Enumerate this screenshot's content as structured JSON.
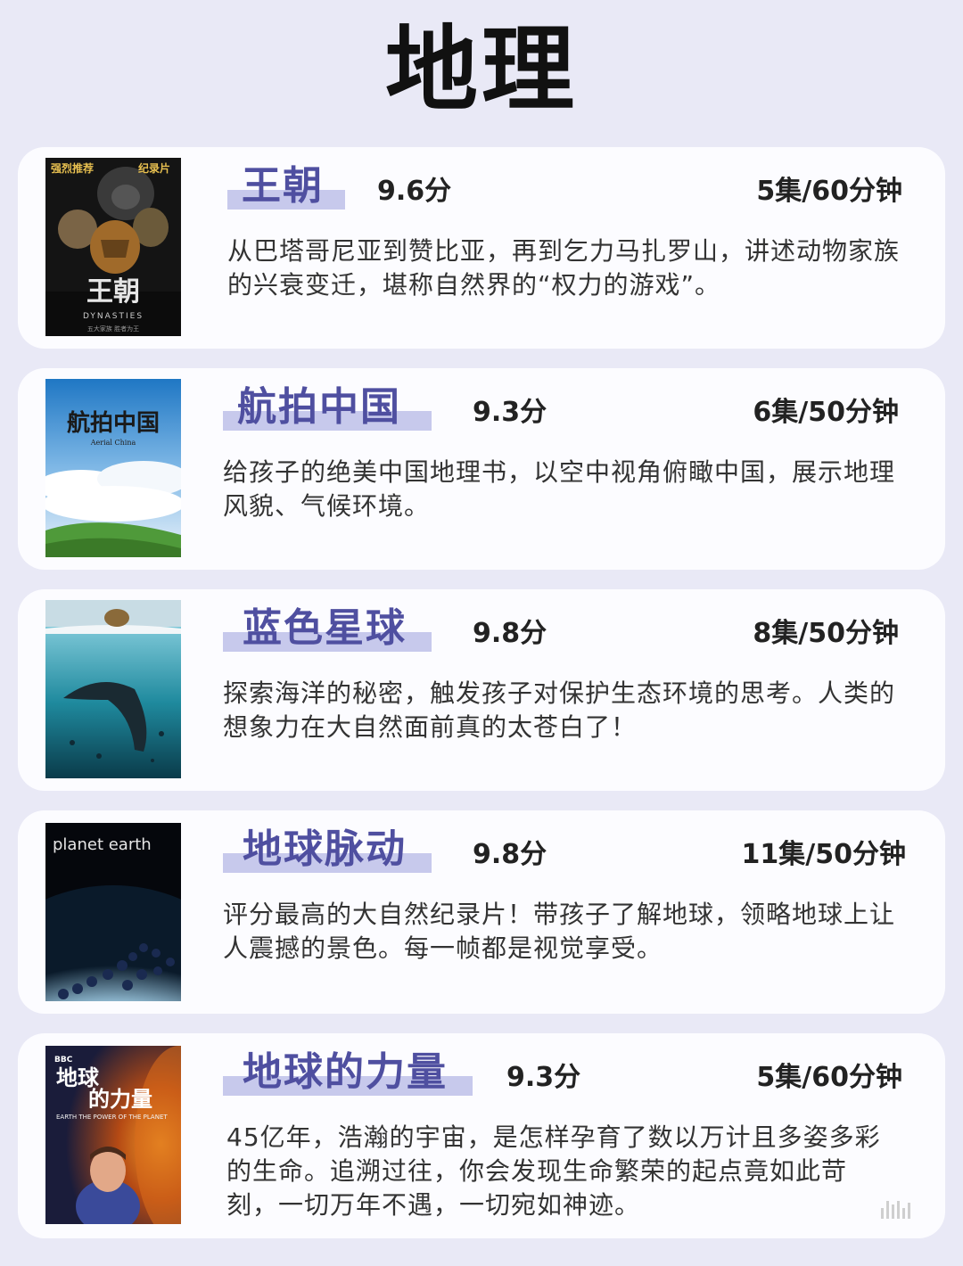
{
  "page": {
    "title": "地理"
  },
  "items": [
    {
      "name": "王朝",
      "score": "9.6分",
      "episodes": "5集/60分钟",
      "description": "从巴塔哥尼亚到赞比亚，再到乞力马扎罗山，讲述动物家族的兴衰变迁，堪称自然界的“权力的游戏”。",
      "poster": {
        "top_left": "强烈推荐",
        "top_right": "纪录片",
        "title": "王朝",
        "subtitle": "DYNASTIES",
        "tagline": "五大家族 胜者为王"
      }
    },
    {
      "name": "航拍中国",
      "score": "9.3分",
      "episodes": "6集/50分钟",
      "description": "给孩子的绝美中国地理书，以空中视角俯瞰中国，展示地理风貌、气候环境。",
      "poster": {
        "title": "航拍中国",
        "subtitle": "Aerial China"
      }
    },
    {
      "name": "蓝色星球",
      "score": "9.8分",
      "episodes": "8集/50分钟",
      "description": "探索海洋的秘密，触发孩子对保护生态环境的思考。人类的想象力在大自然面前真的太苍白了！",
      "poster": {}
    },
    {
      "name": "地球脉动",
      "score": "9.8分",
      "episodes": "11集/50分钟",
      "description": "评分最高的大自然纪录片！带孩子了解地球，领略地球上让人震撼的景色。每一帧都是视觉享受。",
      "poster": {
        "title": "planet earth"
      }
    },
    {
      "name": "地球的力量",
      "score": "9.3分",
      "episodes": "5集/60分钟",
      "description": "45亿年，浩瀚的宇宙，是怎样孕育了数以万计且多姿多彩的生命。追溯过往，你会发现生命繁荣的起点竟如此苛刻，一切万年不遇，一切宛如神迹。",
      "poster": {
        "network": "BBC",
        "title_line1": "地球",
        "title_line2": "的力量",
        "subtitle": "EARTH THE POWER OF THE PLANET"
      }
    }
  ],
  "colors": {
    "background": "#e9e9f6",
    "card": "#fcfcff",
    "name": "#4f4fa0",
    "highlight": "#c7c9ec"
  }
}
